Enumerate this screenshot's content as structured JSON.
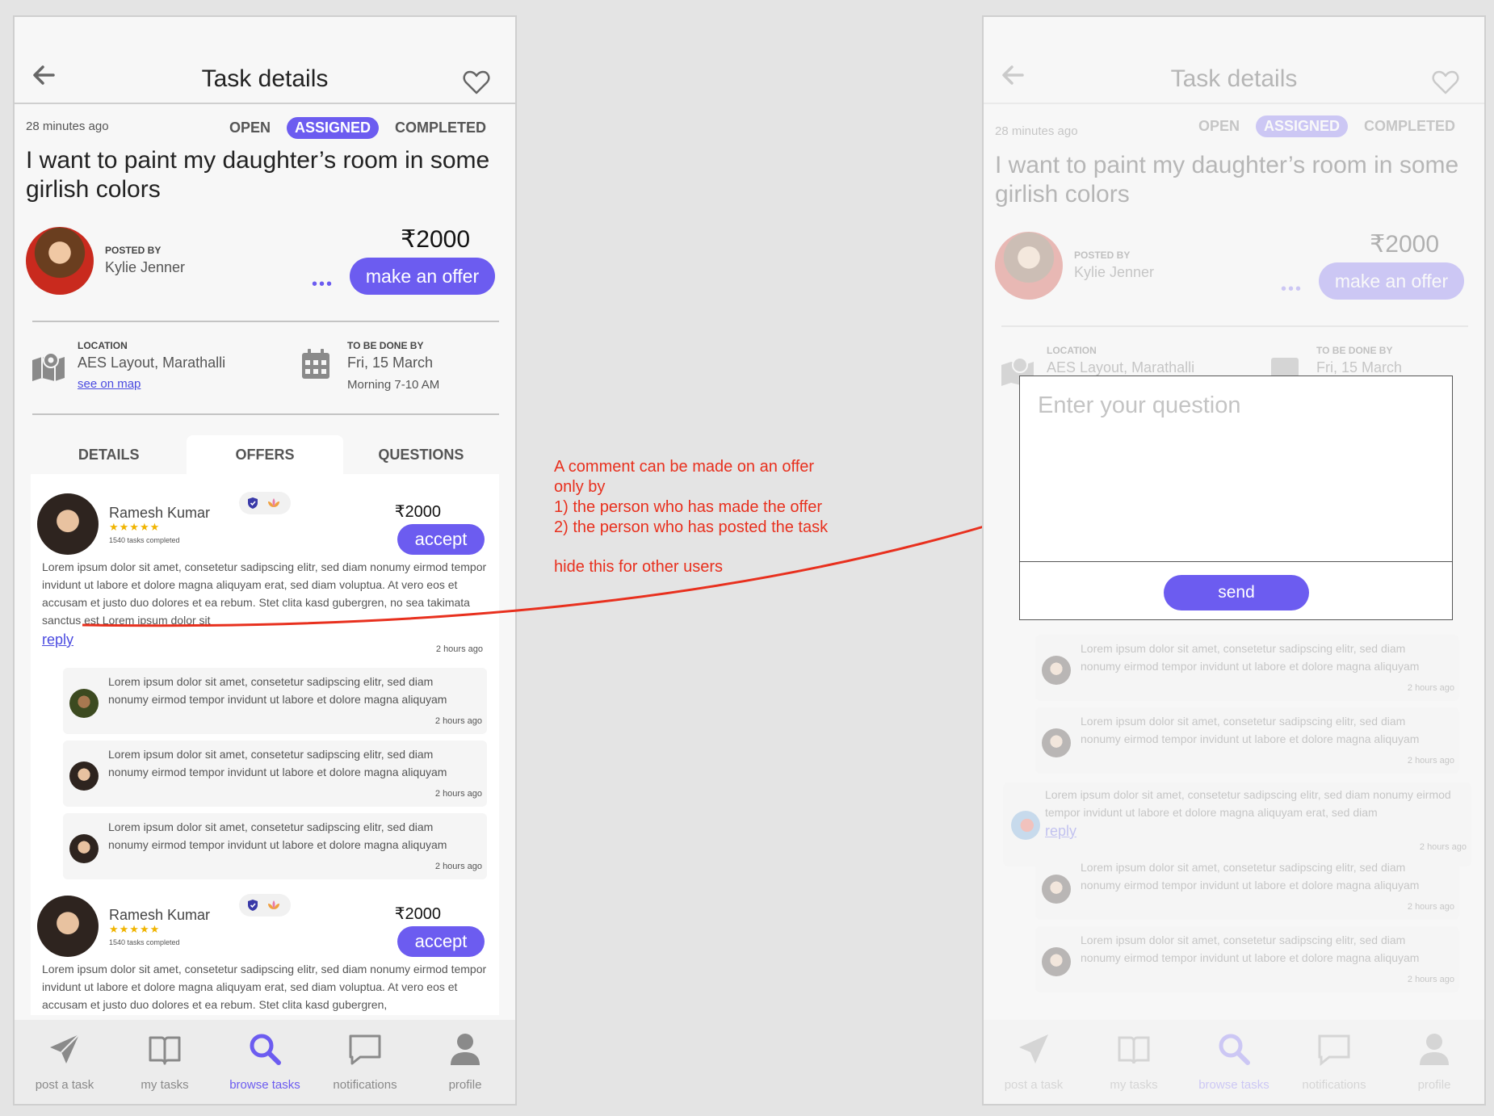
{
  "screen": {
    "title": "Task details",
    "time_ago": "28 minutes ago",
    "statuses": [
      "OPEN",
      "ASSIGNED",
      "COMPLETED"
    ],
    "active_status": "ASSIGNED",
    "task_title": "I want to paint my daughter’s room in some girlish colors",
    "posted_by_label": "POSTED BY",
    "poster_name": "Kylie Jenner",
    "price": "₹2000",
    "more_label": "•••",
    "make_offer_label": "make an offer",
    "location_label": "LOCATION",
    "location_value": "AES Layout, Marathalli",
    "see_on_map": "see on map",
    "due_label": "TO BE DONE BY",
    "due_date": "Fri, 15 March",
    "due_time": "Morning 7-10 AM",
    "tabs": [
      "DETAILS",
      "OFFERS",
      "QUESTIONS"
    ],
    "active_tab": "OFFERS"
  },
  "offers": [
    {
      "name": "Ramesh Kumar",
      "stars": "★★★★★",
      "rating": 5,
      "tasks_completed": "1540 tasks completed",
      "price": "₹2000",
      "accept_label": "accept",
      "text": "Lorem ipsum dolor sit amet, consetetur sadipscing elitr, sed diam nonumy eirmod tempor invidunt ut labore et dolore magna aliquyam erat, sed diam voluptua. At vero eos et accusam et justo duo dolores et ea rebum. Stet clita kasd gubergren, no sea takimata sanctus est Lorem ipsum dolor sit",
      "reply_label": "reply",
      "time": "2 hours ago",
      "comments": [
        {
          "text": "Lorem ipsum dolor sit amet, consetetur sadipscing elitr, sed diam nonumy eirmod tempor invidunt ut labore et dolore magna aliquyam",
          "time": "2 hours ago"
        },
        {
          "text": "Lorem ipsum dolor sit amet, consetetur sadipscing elitr, sed diam nonumy eirmod tempor invidunt ut labore et dolore magna aliquyam",
          "time": "2 hours ago"
        },
        {
          "text": "Lorem ipsum dolor sit amet, consetetur sadipscing elitr, sed diam nonumy eirmod tempor invidunt ut labore et dolore magna aliquyam",
          "time": "2 hours ago"
        }
      ]
    },
    {
      "name": "Ramesh Kumar",
      "stars": "★★★★★",
      "rating": 5,
      "tasks_completed": "1540 tasks completed",
      "price": "₹2000",
      "accept_label": "accept",
      "text": "Lorem ipsum dolor sit amet, consetetur sadipscing elitr, sed diam nonumy eirmod tempor invidunt ut labore et dolore magna aliquyam erat, sed diam voluptua. At vero eos et accusam et justo duo dolores et ea rebum. Stet clita kasd gubergren,"
    }
  ],
  "nav": [
    {
      "label": "post a task",
      "icon": "paper-plane-icon"
    },
    {
      "label": "my tasks",
      "icon": "book-icon"
    },
    {
      "label": "browse tasks",
      "icon": "search-icon"
    },
    {
      "label": "notifications",
      "icon": "chat-bubble-icon"
    },
    {
      "label": "profile",
      "icon": "person-icon"
    }
  ],
  "active_nav": "browse tasks",
  "question_modal": {
    "placeholder": "Enter your question",
    "send_label": "send"
  },
  "right_thread": {
    "comment_text": "Lorem ipsum dolor sit amet, consetetur sadipscing elitr, sed diam nonumy eirmod tempor invidunt ut labore et dolore magna aliquyam",
    "comment_time": "2 hours ago",
    "parent_text": "Lorem ipsum dolor sit amet, consetetur sadipscing elitr, sed diam nonumy eirmod tempor invidunt ut labore et dolore magna aliquyam erat, sed diam",
    "parent_reply": "reply",
    "parent_time": "2 hours ago"
  },
  "annotation": {
    "lines": [
      "A comment can be made on an offer",
      "only by",
      "1) the person who has made the offer",
      "2) the person who has posted the task"
    ],
    "footer": "hide this for other users"
  },
  "colors": {
    "accent": "#6c5cf0",
    "annotation": "#e8301e",
    "star": "#f0b400",
    "link": "#4a4ae0"
  }
}
